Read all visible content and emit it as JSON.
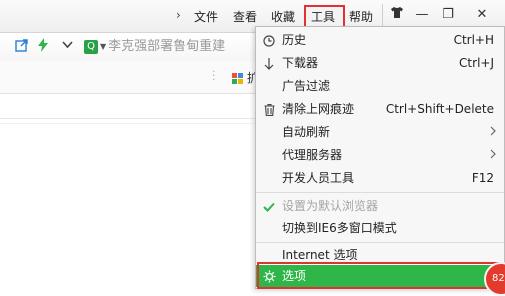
{
  "menubar": {
    "chevron": "›",
    "items": [
      "文件",
      "查看",
      "收藏",
      "工具",
      "帮助"
    ]
  },
  "window_buttons": {
    "skin_icon": "shirt-icon",
    "minimize": "—",
    "restore": "❐",
    "close": "✕"
  },
  "toolbar": {
    "search_placeholder": "李克强部署鲁甸重建"
  },
  "bookmark_bar": {
    "extension_label": "扩"
  },
  "tools_menu": {
    "items": [
      {
        "label": "历史",
        "shortcut": "Ctrl+H",
        "icon": "clock-icon"
      },
      {
        "label": "下载器",
        "shortcut": "Ctrl+J",
        "icon": "download-arrow-icon"
      },
      {
        "label": "广告过滤",
        "shortcut": "",
        "icon": ""
      },
      {
        "label": "清除上网痕迹",
        "shortcut": "Ctrl+Shift+Delete",
        "icon": "trash-icon"
      },
      {
        "label": "自动刷新",
        "shortcut": "",
        "icon": "",
        "submenu": true
      },
      {
        "label": "代理服务器",
        "shortcut": "",
        "icon": "",
        "submenu": true
      },
      {
        "label": "开发人员工具",
        "shortcut": "F12",
        "icon": ""
      },
      {
        "label": "设置为默认浏览器",
        "shortcut": "",
        "icon": "checkmark-icon",
        "disabled": true
      },
      {
        "label": "切换到IE6多窗口模式",
        "shortcut": "",
        "icon": ""
      },
      {
        "label": "Internet 选项",
        "shortcut": "",
        "icon": ""
      },
      {
        "label": "选项",
        "shortcut": "",
        "icon": "gear-icon",
        "selected": true
      }
    ]
  },
  "notification_badge": "82",
  "colors": {
    "highlight_red": "#e03232",
    "selected_green": "#2fb648",
    "badge_red": "#e23b2e"
  }
}
